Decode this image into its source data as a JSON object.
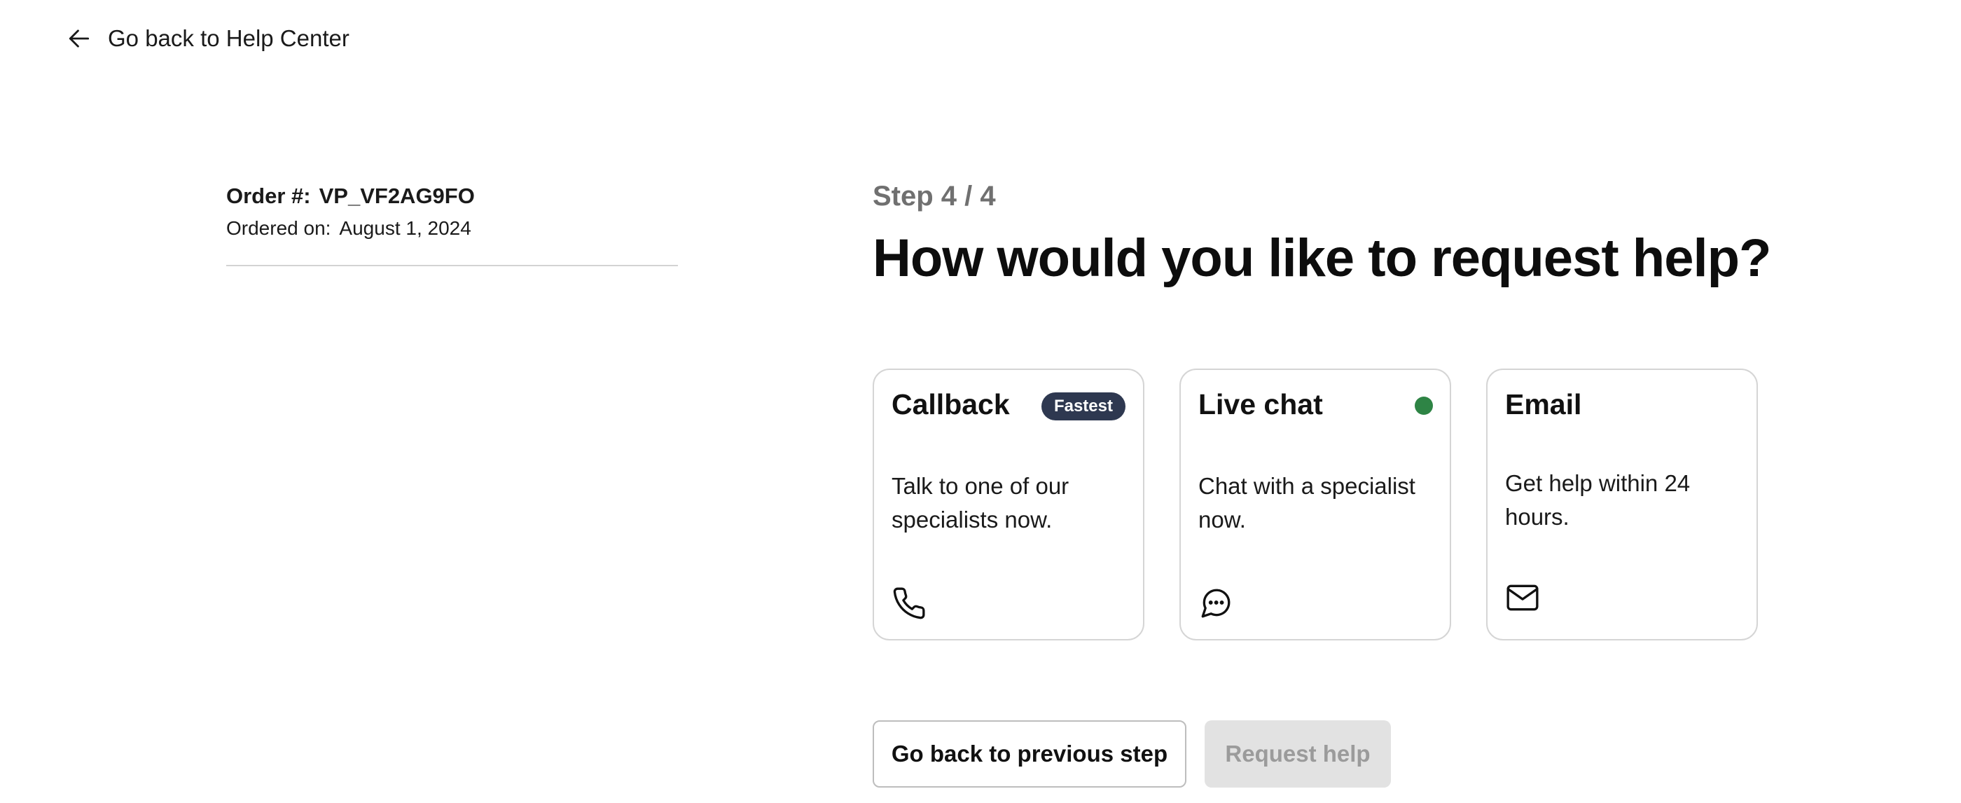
{
  "nav": {
    "back_label": "Go back to Help Center"
  },
  "order": {
    "number_label": "Order #:",
    "number": "VP_VF2AG9FO",
    "date_label": "Ordered on:",
    "date": "August 1, 2024"
  },
  "step": {
    "indicator": "Step 4 / 4",
    "title": "How would you like to request help?"
  },
  "options": [
    {
      "title": "Callback",
      "badge": "Fastest",
      "description": "Talk to one of our specialists now.",
      "icon": "phone-icon"
    },
    {
      "title": "Live chat",
      "status": "online",
      "status_color": "#2e8445",
      "description": "Chat with a specialist now.",
      "icon": "chat-bubble-icon"
    },
    {
      "title": "Email",
      "description": "Get help within 24 hours.",
      "icon": "mail-icon"
    }
  ],
  "actions": {
    "back_label": "Go back to previous step",
    "submit_label": "Request help",
    "submit_disabled": true
  },
  "colors": {
    "badge_bg": "#2e3850",
    "online_dot": "#2e8445",
    "disabled_bg": "#e2e2e2",
    "disabled_text": "#9b9b9b"
  }
}
